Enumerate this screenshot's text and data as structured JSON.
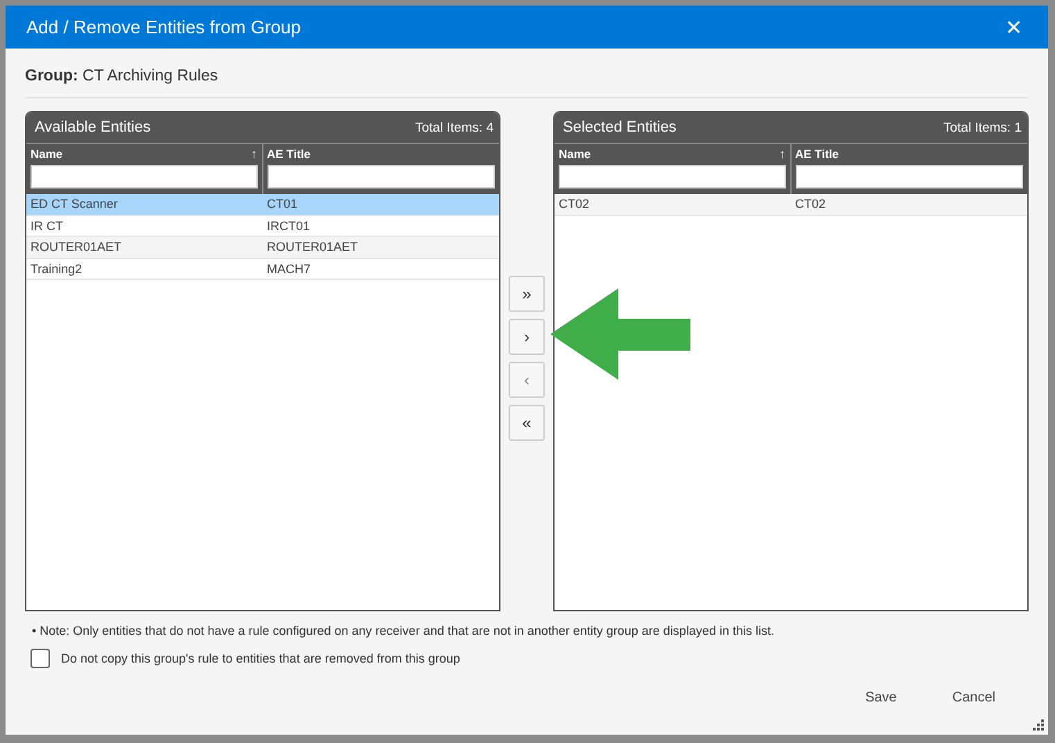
{
  "dialog": {
    "title": "Add / Remove Entities from Group",
    "close": "✕"
  },
  "group": {
    "label": "Group:",
    "value": "CT Archiving Rules"
  },
  "panels": [
    {
      "title": "Available Entities",
      "total": "Total Items: 4",
      "columns": [
        {
          "label": "Name",
          "sort": "↑"
        },
        {
          "label": "AE Title"
        }
      ],
      "rows": [
        {
          "cells": [
            "ED CT Scanner",
            "CT01"
          ],
          "selected": true
        },
        {
          "cells": [
            "IR CT",
            "IRCT01"
          ],
          "selected": false
        },
        {
          "cells": [
            "ROUTER01AET",
            "ROUTER01AET"
          ],
          "selected": false
        },
        {
          "cells": [
            "Training2",
            "MACH7"
          ],
          "selected": false
        }
      ]
    },
    {
      "title": "Selected Entities",
      "total": "Total Items: 1",
      "columns": [
        {
          "label": "Name",
          "sort": "↑"
        },
        {
          "label": "AE Title"
        }
      ],
      "rows": [
        {
          "cells": [
            "CT02",
            "CT02"
          ],
          "selected": false
        }
      ]
    }
  ],
  "move_buttons": [
    {
      "label": "»",
      "disabled": false
    },
    {
      "label": "›",
      "disabled": false
    },
    {
      "label": "‹",
      "disabled": true
    },
    {
      "label": "«",
      "disabled": false
    }
  ],
  "note": "• Note: Only entities that do not have a rule configured on any receiver and that are not in another entity group are displayed in this list.",
  "option": {
    "label": "Do not copy this group's rule to entities that are removed from this group",
    "checked": false
  },
  "buttons": [
    "Save",
    "Cancel"
  ]
}
